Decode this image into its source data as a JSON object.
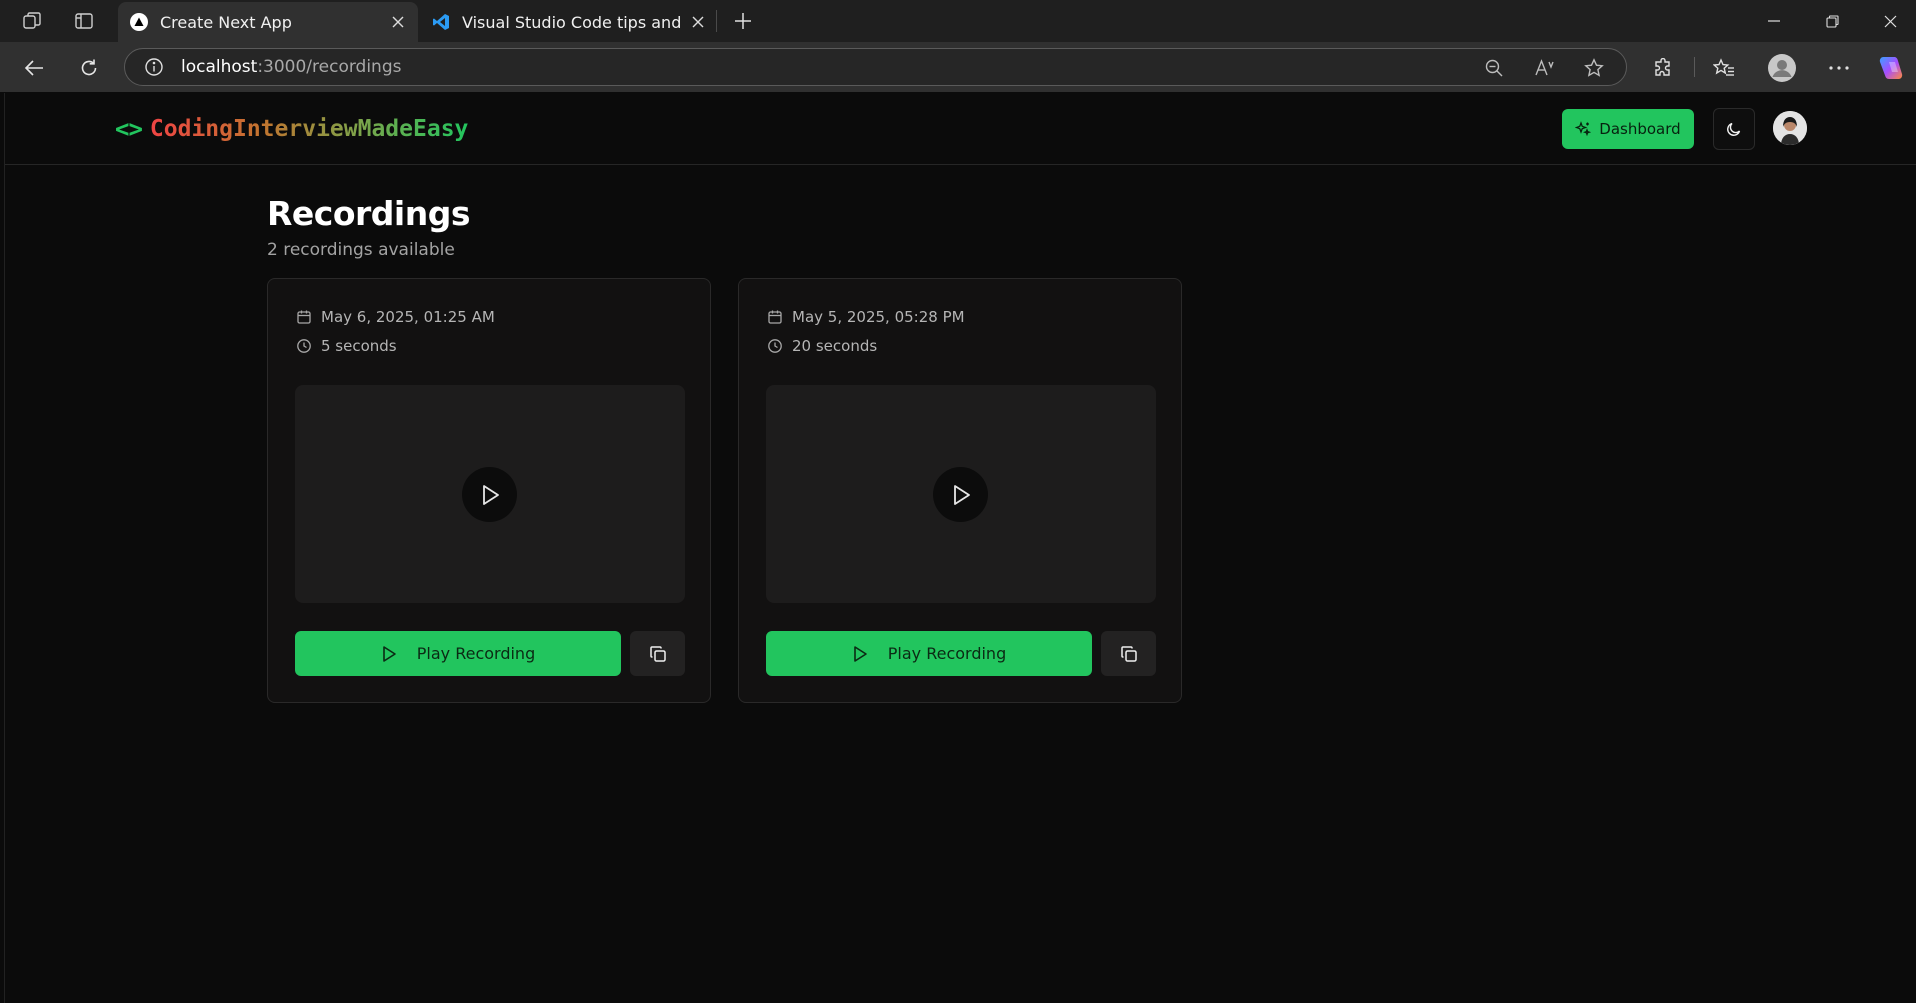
{
  "browser": {
    "tabs": [
      {
        "title": "Create Next App",
        "active": true
      },
      {
        "title": "Visual Studio Code tips and tricks",
        "active": false
      }
    ],
    "url_host": "localhost",
    "url_path": ":3000/recordings"
  },
  "header": {
    "logo_brackets": "<>",
    "logo_text": "CodingInterviewMadeEasy",
    "dashboard_label": "Dashboard"
  },
  "main": {
    "title": "Recordings",
    "subtitle": "2 recordings available",
    "recordings": [
      {
        "date": "May 6, 2025, 01:25 AM",
        "duration": "5 seconds",
        "play_label": "Play Recording"
      },
      {
        "date": "May 5, 2025, 05:28 PM",
        "duration": "20 seconds",
        "play_label": "Play Recording"
      }
    ]
  },
  "colors": {
    "accent": "#22c55e",
    "background": "#0b0b0b",
    "card": "#121111"
  }
}
